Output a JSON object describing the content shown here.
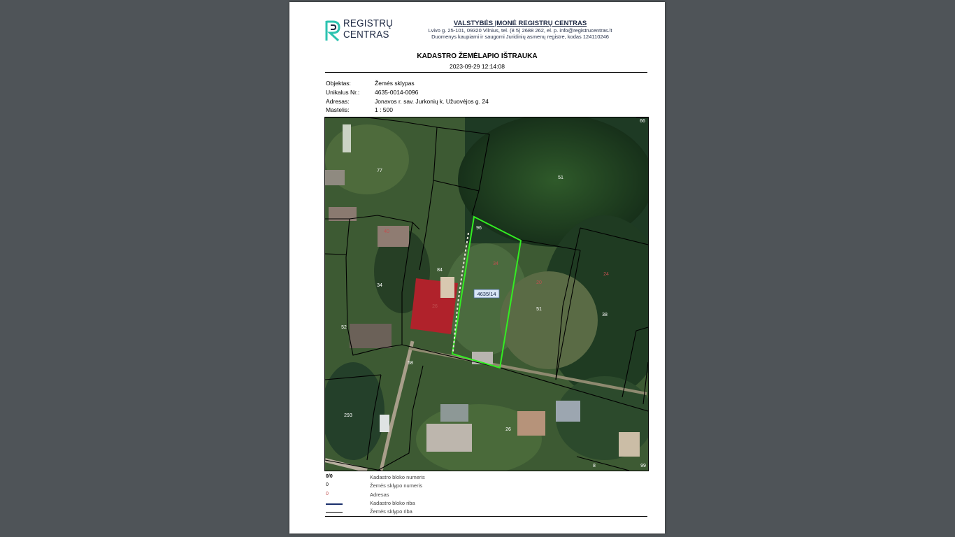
{
  "header": {
    "logo_line1": "REGISTRŲ",
    "logo_line2": "CENTRAS",
    "org_name": "VALSTYBĖS ĮMONĖ REGISTRŲ CENTRAS",
    "org_address": "Lvivo g. 25-101, 09320 Vilnius, tel. (8 5) 2688 262, el. p. info@registrucentras.lt",
    "org_note": "Duomenys kaupiami ir saugomi Juridinių asmenų registre, kodas 124110246"
  },
  "document": {
    "title": "KADASTRO ŽEMĖLAPIO IŠTRAUKA",
    "date": "2023-09-29 12:14:08"
  },
  "info": [
    {
      "label": "Objektas:",
      "value": "Žemės sklypas"
    },
    {
      "label": "Unikalus Nr.:",
      "value": "4635-0014-0096"
    },
    {
      "label": "Adresas:",
      "value": "Jonavos r. sav. Jurkonių k. Užuovėjos g. 24"
    },
    {
      "label": "Mastelis:",
      "value": "1 : 500"
    }
  ],
  "map": {
    "plot_label": "4635/14",
    "parcel_numbers": [
      "66",
      "77",
      "51",
      "96",
      "40",
      "34",
      "24",
      "20",
      "84",
      "26",
      "22",
      "51",
      "38",
      "34",
      "52",
      "58",
      "293",
      "26",
      "8",
      "99"
    ],
    "colors": {
      "selected_plot": "#33ee22",
      "parcel_line": "#000000",
      "address": "#c05050"
    }
  },
  "legend": [
    {
      "symbol": "0/0",
      "label": "Kadastro bloko numeris"
    },
    {
      "symbol": "0",
      "label": "Žemės sklypo numeris"
    },
    {
      "symbol": "0",
      "label": "Adresas"
    },
    {
      "symbol": "",
      "label": "Kadastro bloko riba"
    },
    {
      "symbol": "",
      "label": "Žemės sklypo riba"
    }
  ]
}
